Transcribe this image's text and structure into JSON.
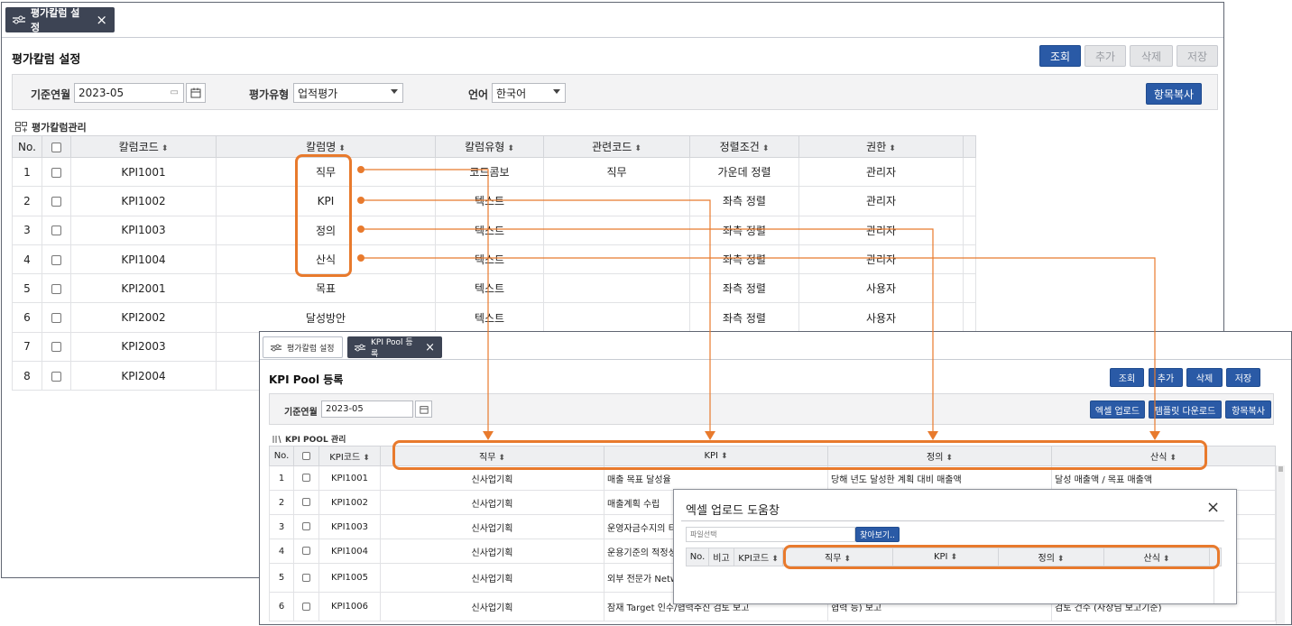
{
  "win1": {
    "tab_label": "평가칼럼 설정",
    "close": "×",
    "title": "평가칼럼 설정",
    "buttons": {
      "search": "조회",
      "add": "추가",
      "delete": "삭제",
      "save": "저장",
      "copy": "항목복사"
    },
    "filters": {
      "base_label": "기준연월",
      "base_value": "2023-05",
      "type_label": "평가유형",
      "type_value": "업적평가",
      "lang_label": "언어",
      "lang_value": "한국어"
    },
    "section": "평가칼럼관리",
    "table": {
      "headers": [
        "No.",
        "",
        "칼럼코드",
        "칼럼명",
        "칼럼유형",
        "관련코드",
        "정렬조건",
        "권한"
      ],
      "rows": [
        [
          "1",
          "KPI1001",
          "직무",
          "코드콤보",
          "직무",
          "가운데 정렬",
          "관리자"
        ],
        [
          "2",
          "KPI1002",
          "KPI",
          "텍스트",
          "",
          "좌측 정렬",
          "관리자"
        ],
        [
          "3",
          "KPI1003",
          "정의",
          "텍스트",
          "",
          "좌측 정렬",
          "관리자"
        ],
        [
          "4",
          "KPI1004",
          "산식",
          "텍스트",
          "",
          "좌측 정렬",
          "관리자"
        ],
        [
          "5",
          "KPI2001",
          "목표",
          "텍스트",
          "",
          "좌측 정렬",
          "사용자"
        ],
        [
          "6",
          "KPI2002",
          "달성방안",
          "텍스트",
          "",
          "좌측 정렬",
          "사용자"
        ],
        [
          "7",
          "KPI2003",
          "",
          "",
          "",
          "",
          ""
        ],
        [
          "8",
          "KPI2004",
          "",
          "",
          "",
          "",
          ""
        ]
      ]
    }
  },
  "win2": {
    "tab1_label": "평가칼럼 설정",
    "tab2_label": "KPI Pool 등록",
    "close": "×",
    "title": "KPI Pool 등록",
    "buttons": {
      "search": "조회",
      "add": "추가",
      "delete": "삭제",
      "save": "저장",
      "excel": "엑셀 업로드",
      "template": "템플릿 다운로드",
      "copy": "항목복사"
    },
    "filters": {
      "base_label": "기준연월",
      "base_value": "2023-05"
    },
    "section": "KPI POOL 관리",
    "table": {
      "headers": [
        "No.",
        "",
        "KPI코드",
        "직무",
        "KPI",
        "정의",
        "산식"
      ],
      "rows": [
        [
          "1",
          "KPI1001",
          "신사업기획",
          "매출 목표 달성율",
          "당해 년도 달성한 계획 대비 매출액",
          "달성 매출액 / 목표 매출액"
        ],
        [
          "2",
          "KPI1002",
          "신사업기획",
          "매출계획 수립",
          "",
          ""
        ],
        [
          "3",
          "KPI1003",
          "신사업기획",
          "운영자금수지의 티",
          "",
          ""
        ],
        [
          "4",
          "KPI1004",
          "신사업기획",
          "운용기준의 적정성",
          "",
          ""
        ],
        [
          "5",
          "KPI1005",
          "신사업기획",
          "외부 전문가 Netw",
          "",
          ""
        ],
        [
          "6",
          "KPI1006",
          "신사업기획",
          "잠재 Target 인수/협력추진 검토 보고",
          "협력 등) 보고",
          "검토 건수 (사장님 보고기준)"
        ]
      ]
    }
  },
  "dialog": {
    "title": "엑셀 업로드 도움창",
    "close": "×",
    "file_placeholder": "파일선택",
    "browse": "찾아보기..",
    "headers": [
      "No.",
      "비고",
      "KPI코드",
      "직무",
      "KPI",
      "정의",
      "산식"
    ]
  },
  "colors": {
    "accent": "#e87a2d",
    "button_blue": "#2a5aa6",
    "tab_dark": "#3d4454"
  }
}
